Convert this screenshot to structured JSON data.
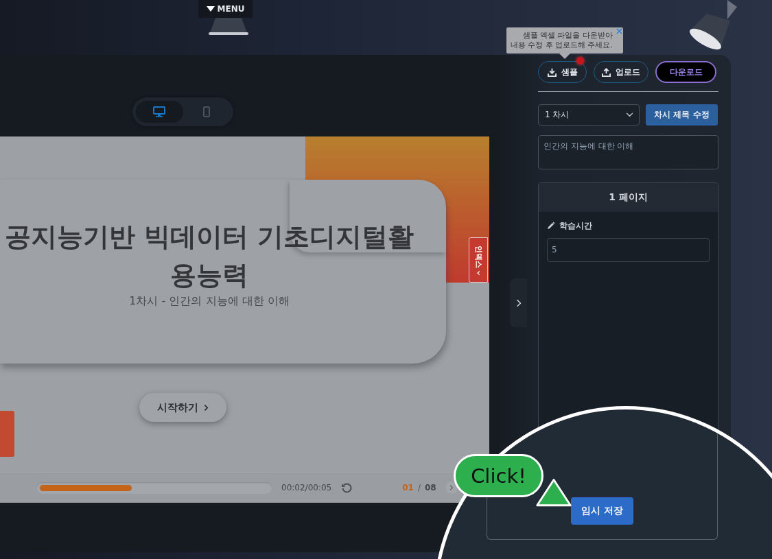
{
  "menu": {
    "label": "MENU"
  },
  "view_toggle": [
    {
      "kind": "desktop",
      "selected": true
    },
    {
      "kind": "mobile",
      "selected": false
    }
  ],
  "slide": {
    "title": "공지능기반 빅데이터 기초디지털활용능력",
    "subtitle": "1차시 - 인간의 지능에 대한 이해",
    "start_button": "시작하기",
    "index_tab": "인덱스"
  },
  "player": {
    "level": 0.4,
    "time": "00:02/00:05",
    "current_page": "01",
    "separator": "/",
    "total_pages": "08"
  },
  "tooltip": {
    "lines": [
      "샘플 엑셀 파일을 다운받아",
      "내용 수정 후 업로드해 주세요."
    ]
  },
  "toolbar": [
    {
      "kind": "sample",
      "label": "샘플",
      "notify": true
    },
    {
      "kind": "upload",
      "label": "업로드",
      "notify": false
    },
    {
      "kind": "download",
      "label": "다운로드",
      "notify": false
    }
  ],
  "session_select": {
    "value": "1 차시"
  },
  "rename_button": "차시 제목 수정",
  "session_title": {
    "value": "인간의 지능에 대한 이해"
  },
  "page_card": {
    "title": "1 페이지",
    "field_label": "학습시간",
    "field_value": "5"
  },
  "save_button": "임시 저장",
  "callout": {
    "text": "Click!"
  }
}
